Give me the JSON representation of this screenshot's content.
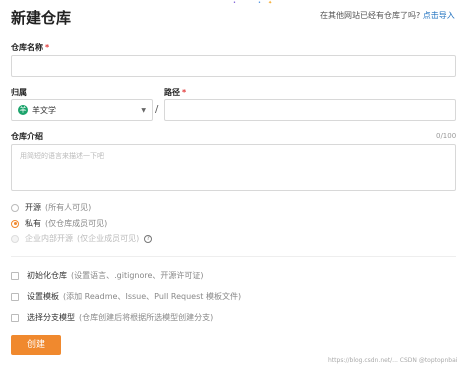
{
  "page": {
    "title": "新建仓库"
  },
  "import_tip": {
    "text": "在其他网站已经有仓库了吗?",
    "link": "点击导入"
  },
  "decor": [
    "•",
    "•",
    "✦"
  ],
  "repo_name": {
    "label": "仓库名称",
    "required": "*",
    "value": ""
  },
  "owner": {
    "label": "归属",
    "avatar_letter": "羊",
    "name": "羊文学",
    "caret": "▼"
  },
  "path": {
    "label": "路径",
    "required": "*",
    "separator": "/",
    "value": ""
  },
  "description": {
    "label": "仓库介绍",
    "counter": "0/100",
    "placeholder": "用简短的语言来描述一下吧"
  },
  "visibility": {
    "options": [
      {
        "label": "开源",
        "hint": "(所有人可见)"
      },
      {
        "label": "私有",
        "hint": "(仅仓库成员可见)"
      },
      {
        "label": "企业内部开源",
        "hint": "(仅企业成员可见)"
      }
    ],
    "help_glyph": "?"
  },
  "options": [
    {
      "label": "初始化仓库",
      "hint": "(设置语言、.gitignore、开源许可证)"
    },
    {
      "label": "设置模板",
      "hint": "(添加 Readme、Issue、Pull Request 模板文件)"
    },
    {
      "label": "选择分支模型",
      "hint": "(仓库创建后将根据所选模型创建分支)"
    }
  ],
  "create_button": {
    "label": "创建"
  },
  "watermark": "https://blog.csdn.net/... CSDN @toptopnbai",
  "colors": {
    "accent": "#f0892e",
    "link": "#1e70bf",
    "avatar": "#1aa36b",
    "required": "#e23b3b"
  }
}
